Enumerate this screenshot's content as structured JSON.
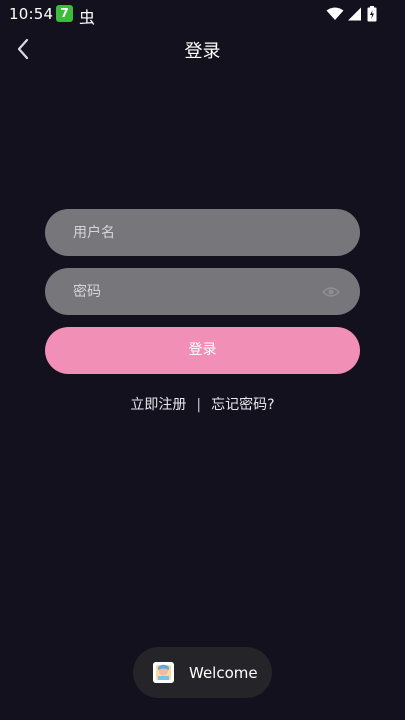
{
  "status_bar": {
    "time": "10:54",
    "app_badge": "7",
    "bug_glyph": "虫",
    "icons": [
      "wifi-icon",
      "cellular-signal-icon",
      "battery-charging-icon"
    ]
  },
  "header": {
    "back_icon": "chevron-left-icon",
    "title": "登录"
  },
  "form": {
    "username_placeholder": "用户名",
    "username_value": "",
    "password_placeholder": "密码",
    "password_value": "",
    "password_toggle_icon": "eye-icon",
    "login_label": "登录"
  },
  "links": {
    "register": "立即注册",
    "separator": "|",
    "forgot_password": "忘记密码?"
  },
  "toast": {
    "icon": "app-icon",
    "message": "Welcome"
  },
  "colors": {
    "background": "#13111d",
    "input_fill": "#77767b",
    "accent": "#f28fb6",
    "toast_fill": "#252429"
  }
}
